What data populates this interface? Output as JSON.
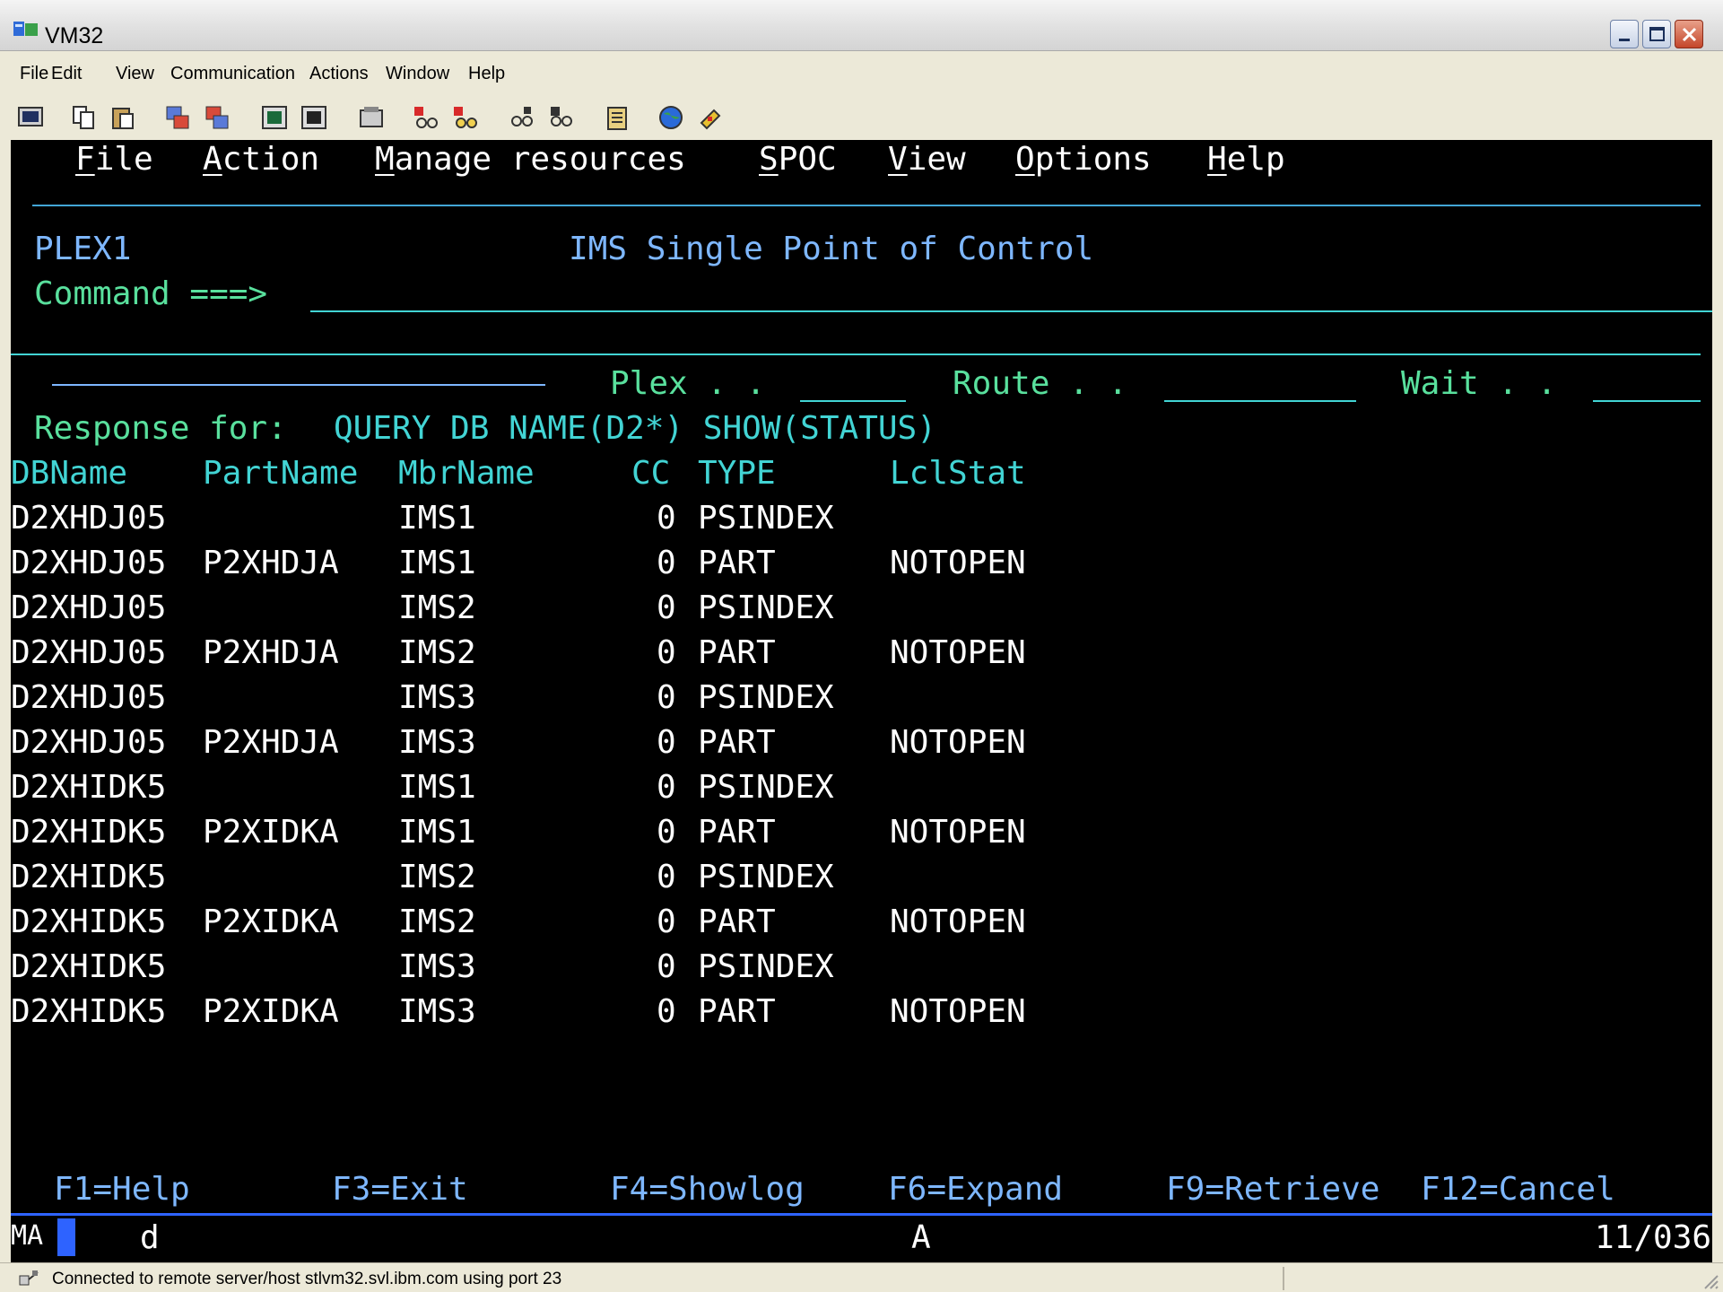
{
  "window": {
    "title": "VM32"
  },
  "menubar": [
    "File",
    "Edit",
    "View",
    "Communication",
    "Actions",
    "Window",
    "Help"
  ],
  "toolbar": [
    "screen-icon",
    "copy-icon",
    "paste-icon",
    "send-file-icon",
    "receive-file-icon",
    "display-icon",
    "display2-icon",
    "macro-icon",
    "play-icon",
    "record-icon",
    "keypad-icon",
    "keyboard-icon",
    "clipboard-icon",
    "globe-icon",
    "key-icon"
  ],
  "spoc": {
    "menu": [
      "File",
      "Action",
      "Manage resources",
      "SPOC",
      "View",
      "Options",
      "Help"
    ],
    "plex_name": "PLEX1",
    "title": "IMS Single Point of Control",
    "command_label": "Command ===>",
    "plex_label": "Plex . .",
    "route_label": "Route . .",
    "wait_label": "Wait . .",
    "response_label": "Response for:",
    "response_command": "QUERY DB NAME(D2*) SHOW(STATUS)",
    "columns": [
      "DBName",
      "PartName",
      "MbrName",
      "CC",
      "TYPE",
      "LclStat"
    ],
    "rows": [
      [
        "D2XHDJ05",
        "",
        "IMS1",
        "0",
        "PSINDEX",
        ""
      ],
      [
        "D2XHDJ05",
        "P2XHDJA",
        "IMS1",
        "0",
        "PART",
        "NOTOPEN"
      ],
      [
        "D2XHDJ05",
        "",
        "IMS2",
        "0",
        "PSINDEX",
        ""
      ],
      [
        "D2XHDJ05",
        "P2XHDJA",
        "IMS2",
        "0",
        "PART",
        "NOTOPEN"
      ],
      [
        "D2XHDJ05",
        "",
        "IMS3",
        "0",
        "PSINDEX",
        ""
      ],
      [
        "D2XHDJ05",
        "P2XHDJA",
        "IMS3",
        "0",
        "PART",
        "NOTOPEN"
      ],
      [
        "D2XHIDK5",
        "",
        "IMS1",
        "0",
        "PSINDEX",
        ""
      ],
      [
        "D2XHIDK5",
        "P2XIDKA",
        "IMS1",
        "0",
        "PART",
        "NOTOPEN"
      ],
      [
        "D2XHIDK5",
        "",
        "IMS2",
        "0",
        "PSINDEX",
        ""
      ],
      [
        "D2XHIDK5",
        "P2XIDKA",
        "IMS2",
        "0",
        "PART",
        "NOTOPEN"
      ],
      [
        "D2XHIDK5",
        "",
        "IMS3",
        "0",
        "PSINDEX",
        ""
      ],
      [
        "D2XHIDK5",
        "P2XIDKA",
        "IMS3",
        "0",
        "PART",
        "NOTOPEN"
      ]
    ],
    "fkeys": [
      "F1=Help",
      "F3=Exit",
      "F4=Showlog",
      "F6=Expand",
      "F9=Retrieve",
      "F12=Cancel"
    ]
  },
  "oia": {
    "left": "MA",
    "mode": "d",
    "indicator": "A",
    "cursor_pos": "11/036"
  },
  "statusbar": {
    "text": "Connected to remote server/host stlvm32.svl.ibm.com using port 23"
  },
  "colors": {
    "terminal_bg": "#000000",
    "green": "#59e09d",
    "blue": "#7eb7ff",
    "white": "#ffffff",
    "turquoise": "#42d4d4"
  }
}
